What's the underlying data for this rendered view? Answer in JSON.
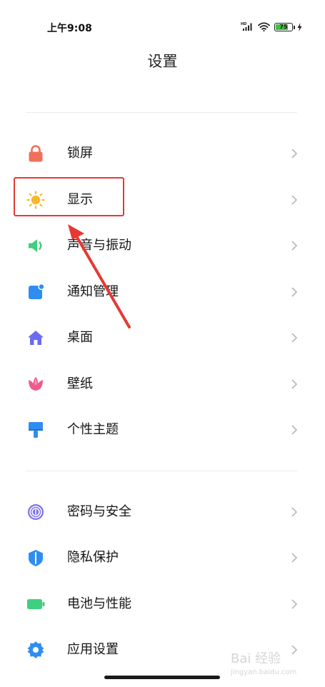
{
  "status_bar": {
    "time": "上午9:08",
    "battery_level": "75",
    "battery_fraction": 0.75,
    "icons": [
      "hd-signal-icon",
      "wifi-icon",
      "battery-icon",
      "charging-icon"
    ]
  },
  "header": {
    "title": "设置"
  },
  "groups": [
    {
      "items": [
        {
          "label": "锁屏",
          "icon": "lock-icon",
          "icon_color": "#f0705a"
        },
        {
          "label": "显示",
          "icon": "sun-icon",
          "icon_color": "#f6b92b"
        },
        {
          "label": "声音与振动",
          "icon": "speaker-icon",
          "icon_color": "#3fcf7f"
        },
        {
          "label": "通知管理",
          "icon": "notification-icon",
          "icon_color": "#2f8df2"
        },
        {
          "label": "桌面",
          "icon": "home-icon",
          "icon_color": "#6a6cf0"
        },
        {
          "label": "壁纸",
          "icon": "flower-icon",
          "icon_color": "#ef5a8a"
        },
        {
          "label": "个性主题",
          "icon": "paintbrush-icon",
          "icon_color": "#2f8df2"
        }
      ]
    },
    {
      "items": [
        {
          "label": "密码与安全",
          "icon": "fingerprint-icon",
          "icon_color": "#7a6ef0"
        },
        {
          "label": "隐私保护",
          "icon": "shield-icon",
          "icon_color": "#2f8df2"
        },
        {
          "label": "电池与性能",
          "icon": "battery-icon",
          "icon_color": "#3fcf7f"
        },
        {
          "label": "应用设置",
          "icon": "gear-icon",
          "icon_color": "#2f8df2"
        }
      ]
    }
  ],
  "annotation": {
    "highlighted_item": "显示",
    "color": "#e53935"
  },
  "watermark": {
    "text": "Bai 经验",
    "subtext": "jingyan.baidu.com"
  }
}
